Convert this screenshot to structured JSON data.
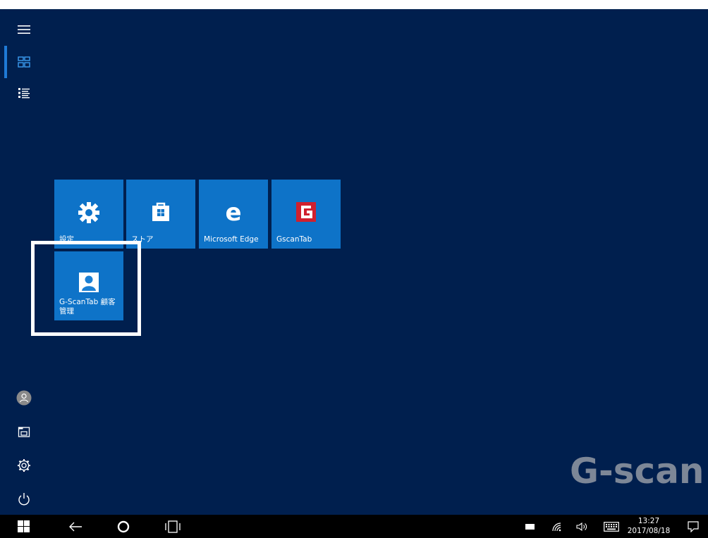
{
  "start_menu": {
    "tiles": [
      {
        "label": "設定",
        "icon": "gear-icon"
      },
      {
        "label": "ストア",
        "icon": "store-bag-icon"
      },
      {
        "label": "Microsoft Edge",
        "icon": "edge-icon"
      },
      {
        "label": "GscanTab",
        "icon": "gscan-icon"
      },
      {
        "label": "G-ScanTab 顧客管理",
        "icon": "user-contact-icon"
      }
    ],
    "rail": {
      "menu": "hamburger-icon",
      "tiles_view": "tiles-view-icon",
      "all_apps": "all-apps-list-icon",
      "user": "user-avatar-icon",
      "explorer": "file-explorer-icon",
      "settings": "settings-icon",
      "power": "power-icon"
    }
  },
  "watermark": {
    "text": "G-scan T"
  },
  "taskbar": {
    "time": "13:27",
    "date": "2017/08/18",
    "icons": [
      "windows-start-icon",
      "back-icon",
      "cortana-icon",
      "task-view-icon",
      "battery-icon",
      "wifi-icon",
      "volume-icon",
      "keyboard-icon",
      "notifications-icon"
    ]
  },
  "colors": {
    "background": "#001f4e",
    "tile": "#0e73c8",
    "accent": "#1f7ad6",
    "gscan_red": "#d0202e"
  }
}
